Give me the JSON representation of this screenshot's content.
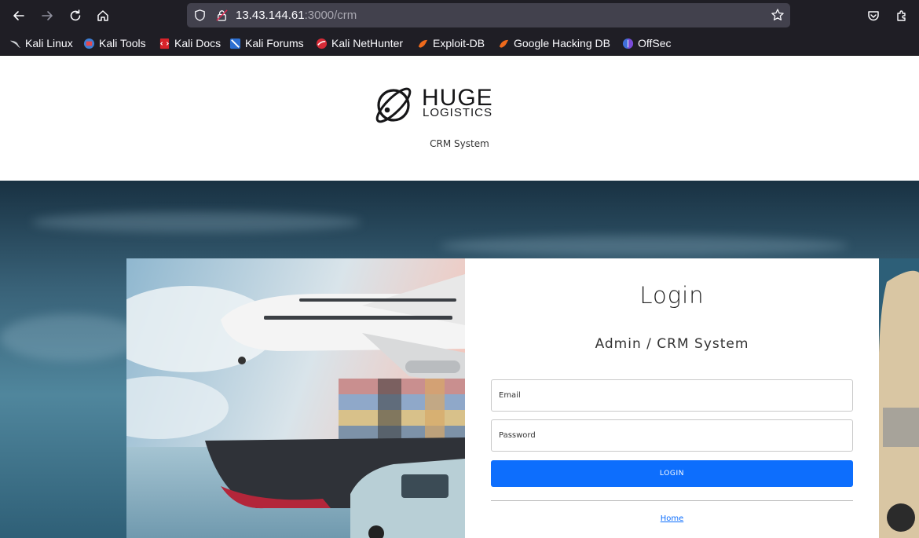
{
  "browser": {
    "url_host": "13.43.144.61",
    "url_rest": ":3000/crm",
    "bookmarks": [
      {
        "label": "Kali Linux",
        "icon": "kali-dragon-icon"
      },
      {
        "label": "Kali Tools",
        "icon": "kali-tools-icon"
      },
      {
        "label": "Kali Docs",
        "icon": "kali-docs-icon"
      },
      {
        "label": "Kali Forums",
        "icon": "kali-forums-icon"
      },
      {
        "label": "Kali NetHunter",
        "icon": "kali-nethunter-icon"
      },
      {
        "label": "Exploit-DB",
        "icon": "exploit-db-icon"
      },
      {
        "label": "Google Hacking DB",
        "icon": "ghdb-icon"
      },
      {
        "label": "OffSec",
        "icon": "offsec-icon"
      }
    ]
  },
  "header": {
    "logo_line1": "HUGE",
    "logo_line2": "LOGISTICS",
    "subtitle": "CRM System"
  },
  "login": {
    "title": "Login",
    "subtitle": "Admin / CRM System",
    "email_placeholder": "Email",
    "password_placeholder": "Password",
    "button_label": "LOGIN",
    "home_link": "Home"
  },
  "colors": {
    "primary": "#0d6efd",
    "chrome_bg": "#1f1e25",
    "urlbar_bg": "#42414d"
  }
}
